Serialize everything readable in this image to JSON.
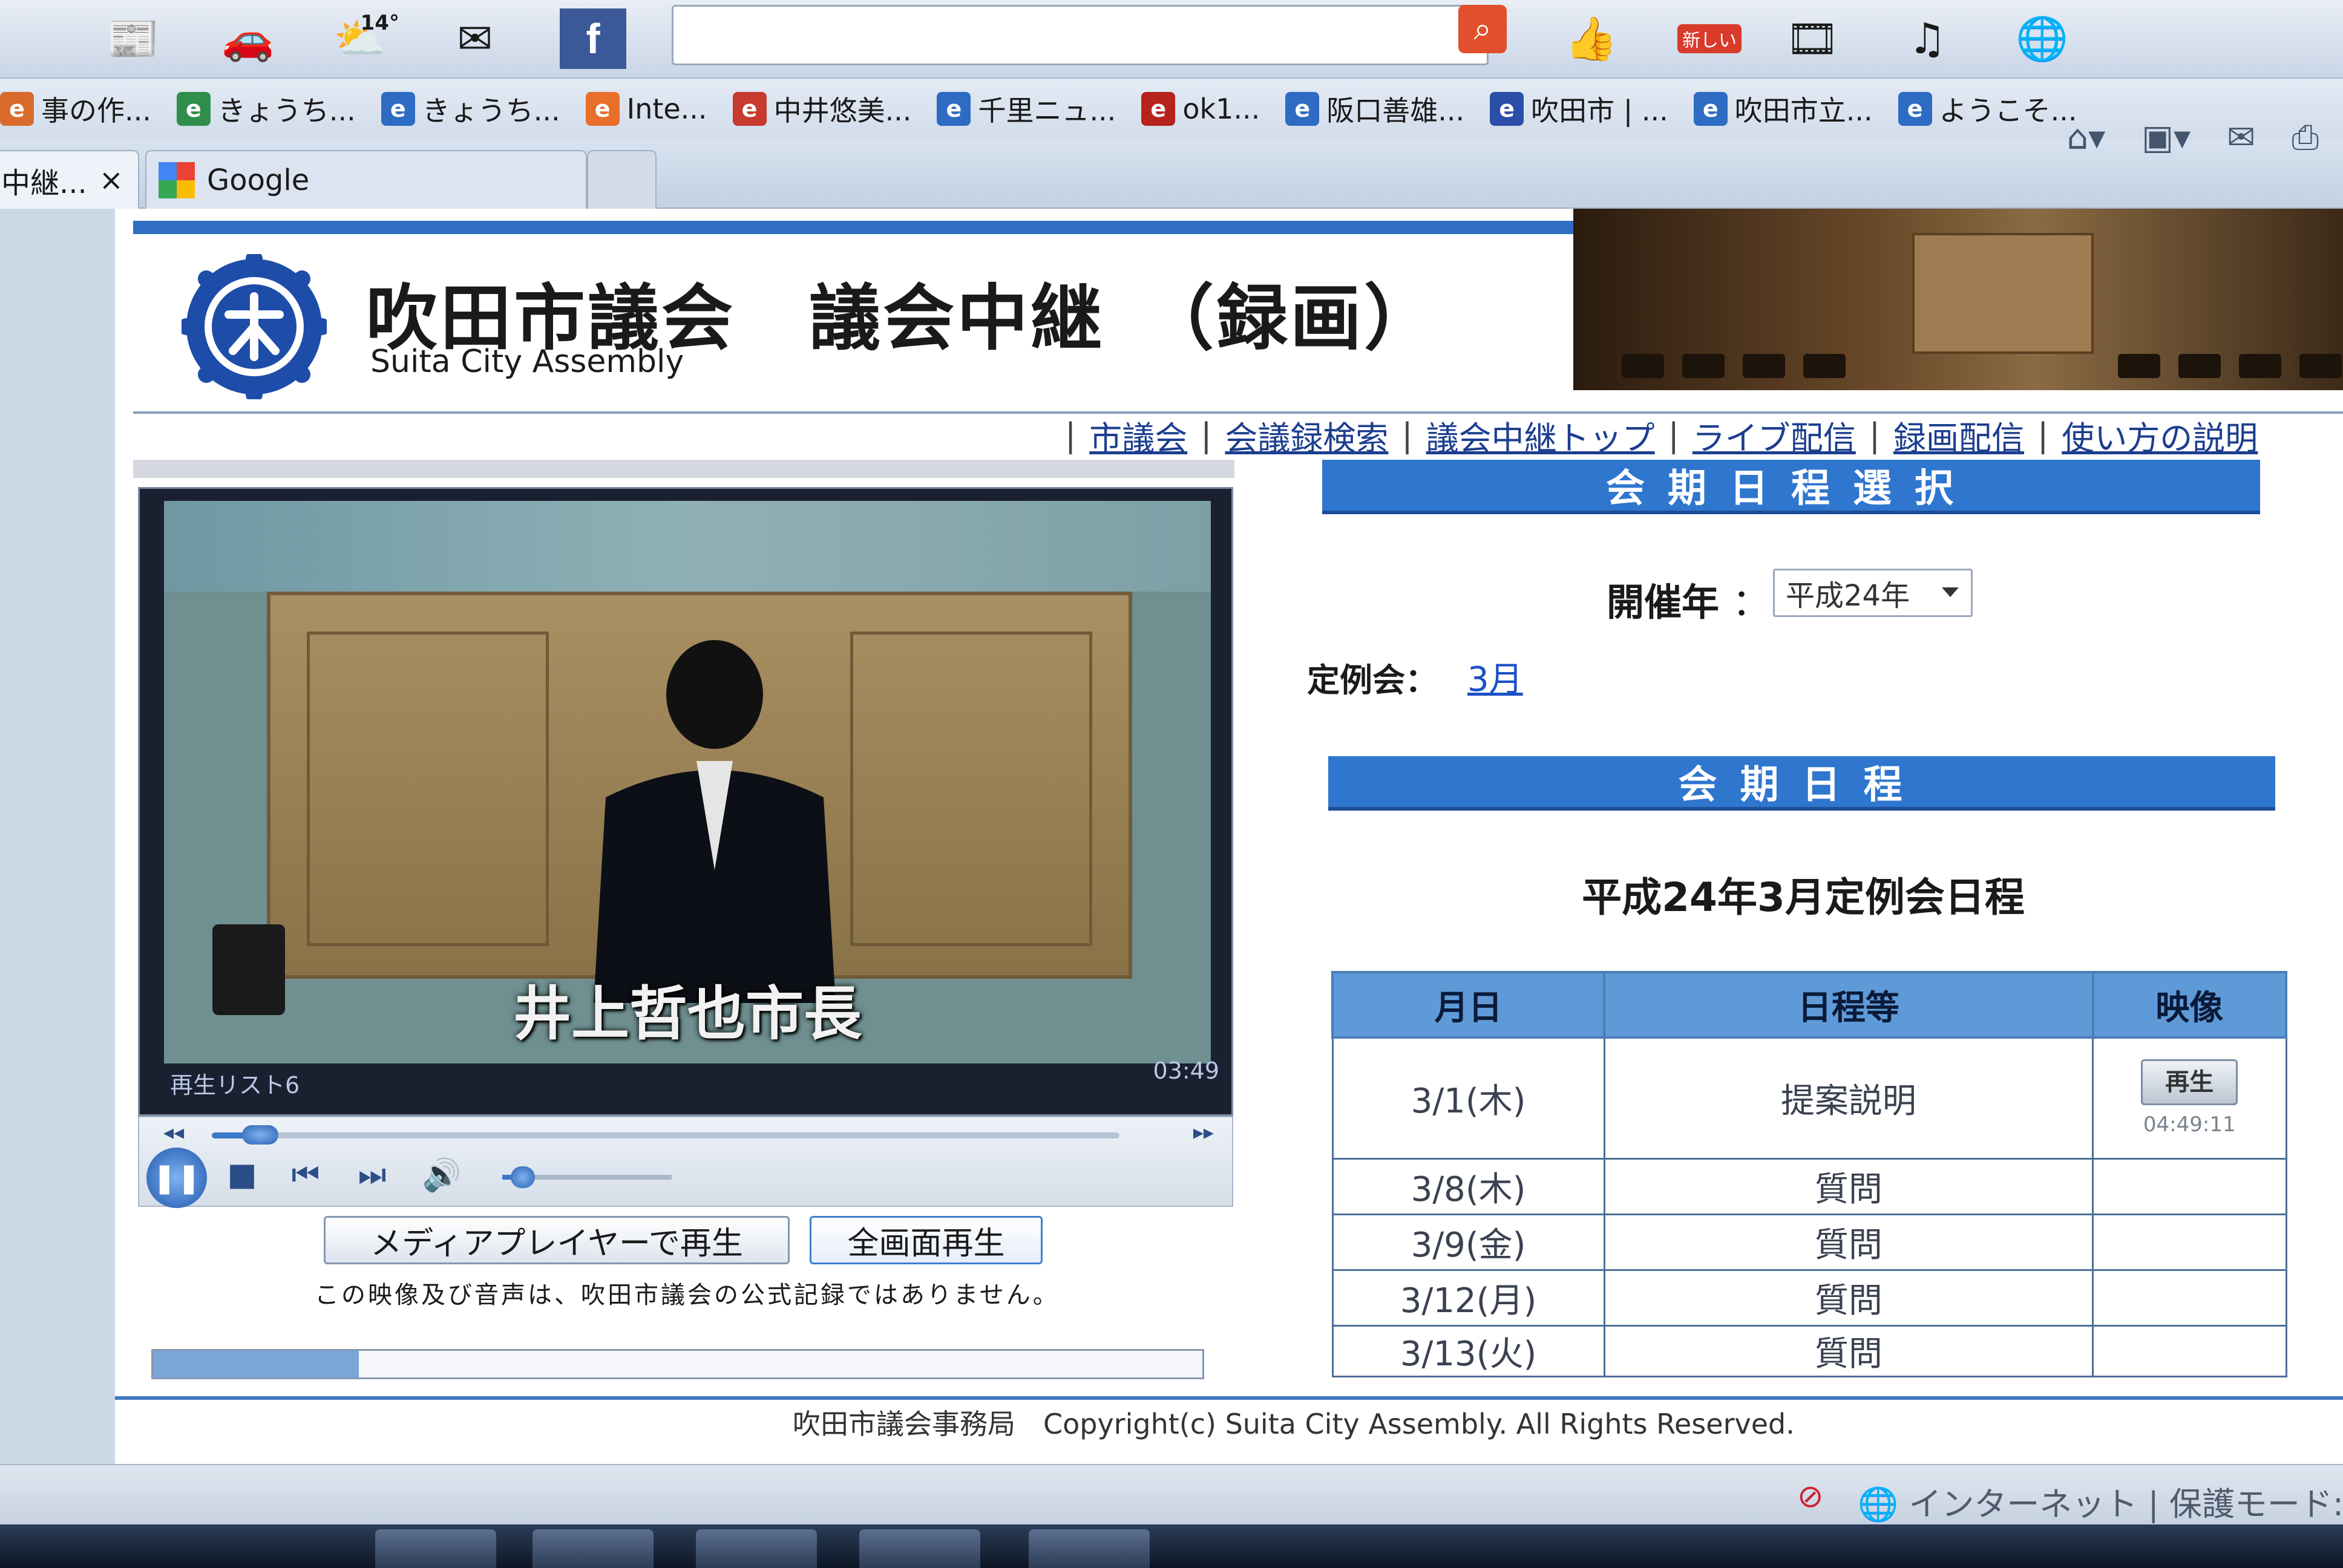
{
  "browser": {
    "weather_temp": "14°",
    "toolbar_badge": "新しい",
    "favorites": [
      {
        "label": "事の作...",
        "color": "#d86b2b"
      },
      {
        "label": "きょうち...",
        "color": "#2f8f4a"
      },
      {
        "label": "きょうち...",
        "color": "#2d6cc2"
      },
      {
        "label": "Inte...",
        "color": "#e8702a"
      },
      {
        "label": "中井悠美...",
        "color": "#c63a2f"
      },
      {
        "label": "千里ニュ...",
        "color": "#2d6cc2"
      },
      {
        "label": "ok1...",
        "color": "#b4231c"
      },
      {
        "label": "阪口善雄...",
        "color": "#2d6cc2"
      },
      {
        "label": "吹田市 | ...",
        "color": "#2b4ea8"
      },
      {
        "label": "吹田市立...",
        "color": "#2d6cc2"
      },
      {
        "label": "ようこそ...",
        "color": "#2d6cc2"
      }
    ],
    "tabs": [
      {
        "label": "中継...",
        "close": "×"
      },
      {
        "label": "Google"
      }
    ]
  },
  "header": {
    "title": "吹田市議会　議会中継　（録画）",
    "subtitle": "Suita City Assembly"
  },
  "nav": {
    "links": [
      "市議会",
      "会議録検索",
      "議会中継トップ",
      "ライブ配信",
      "録画配信",
      "使い方の説明"
    ],
    "separator": "|"
  },
  "video": {
    "caption": "井上哲也市長",
    "playlist_label": "再生リスト6",
    "time": "03:49",
    "seek_progress": 0.02,
    "volume": 0.05
  },
  "player_buttons": {
    "media_player": "メディアプレイヤーで再生",
    "fullscreen": "全画面再生"
  },
  "notice": "この映像及び音声は、吹田市議会の公式記録ではありません。",
  "session_select": {
    "header": "会期日程選択",
    "year_label": "開催年",
    "year_colon": "：",
    "year_value": "平成24年",
    "session_label": "定例会：",
    "session_link": "3月"
  },
  "schedule": {
    "header": "会期日程",
    "title": "平成24年3月定例会日程",
    "columns": [
      "月日",
      "日程等",
      "映像"
    ],
    "rows": [
      {
        "date": "3/1(木)",
        "item": "提案説明",
        "play": "再生",
        "duration": "04:49:11"
      },
      {
        "date": "3/8(木)",
        "item": "質問",
        "play": "",
        "duration": ""
      },
      {
        "date": "3/9(金)",
        "item": "質問",
        "play": "",
        "duration": ""
      },
      {
        "date": "3/12(月)",
        "item": "質問",
        "play": "",
        "duration": ""
      },
      {
        "date": "3/13(火)",
        "item": "質問",
        "play": "",
        "duration": ""
      }
    ]
  },
  "footer": "吹田市議会事務局　Copyright(c) Suita City Assembly. All Rights Reserved.",
  "status_bar": {
    "zone": "インターネット | 保護モード: "
  },
  "colors": {
    "accent": "#2f76cf",
    "link": "#1c3e8f",
    "table_header": "#5f9ad8"
  }
}
